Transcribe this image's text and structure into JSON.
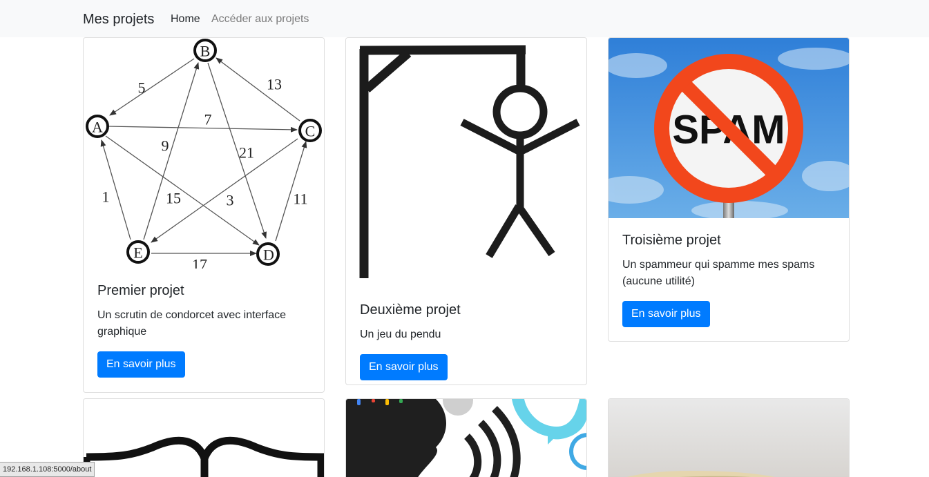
{
  "nav": {
    "brand": "Mes projets",
    "home": "Home",
    "projects_link": "Accéder aux projets"
  },
  "cards": [
    {
      "title": "Premier projet",
      "text": "Un scrutin de condorcet avec interface graphique",
      "button": "En savoir plus",
      "graph": {
        "nodes": [
          "A",
          "B",
          "C",
          "D",
          "E"
        ],
        "edge_weights": [
          "5",
          "13",
          "7",
          "9",
          "21",
          "1",
          "15",
          "3",
          "11",
          "17"
        ]
      }
    },
    {
      "title": "Deuxième projet",
      "text": "Un jeu du pendu",
      "button": "En savoir plus"
    },
    {
      "title": "Troisième projet",
      "text": "Un spammeur qui spamme mes spams (aucune utilité)",
      "button": "En savoir plus",
      "sign_text": "SPAM"
    }
  ],
  "status_url": "192.168.1.108:5000/about",
  "colors": {
    "primary": "#007bff",
    "navbar_bg": "#f8f9fa",
    "spam_sign_red": "#f2471c"
  }
}
